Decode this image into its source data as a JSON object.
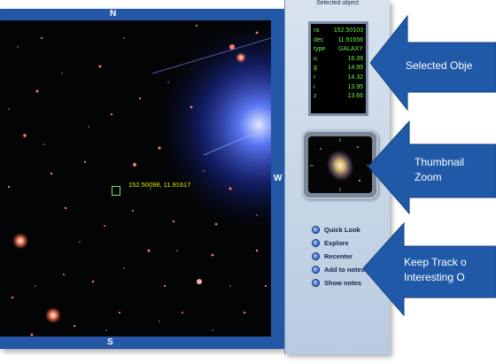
{
  "navigator": {
    "compass_north": "N",
    "compass_south": "S",
    "compass_west": "W",
    "object_label": "152.50098, 11.91617"
  },
  "panel": {
    "title": "Selected object",
    "info": [
      {
        "key": "ra",
        "value": "152.50103"
      },
      {
        "key": "dec",
        "value": "11.91656"
      },
      {
        "key": "type",
        "value": "GALAXY"
      },
      {
        "key": "u",
        "value": "16.39"
      },
      {
        "key": "g",
        "value": "14.99"
      },
      {
        "key": "r",
        "value": "14.32"
      },
      {
        "key": "i",
        "value": "13.95"
      },
      {
        "key": "z",
        "value": "13.66"
      }
    ],
    "actions": [
      {
        "label": "Quick Look",
        "icon": "radio-bullet-icon"
      },
      {
        "label": "Explore",
        "icon": "radio-bullet-icon"
      },
      {
        "label": "Recenter",
        "icon": "radio-bullet-icon"
      },
      {
        "label": "Add to notes",
        "icon": "radio-bullet-icon"
      },
      {
        "label": "Show notes",
        "icon": "radio-bullet-icon"
      }
    ]
  },
  "callouts": {
    "selected_object": "Selected Obje",
    "thumbnail_zoom_line1": "Thumbnail",
    "thumbnail_zoom_line2": "Zoom",
    "keep_track_line1": "Keep Track o",
    "keep_track_line2": "Interesting O"
  },
  "colors": {
    "frame": "#2458a6",
    "callout": "#1f59a8",
    "info_text": "#6cf04a",
    "label_text": "#e6e600"
  }
}
